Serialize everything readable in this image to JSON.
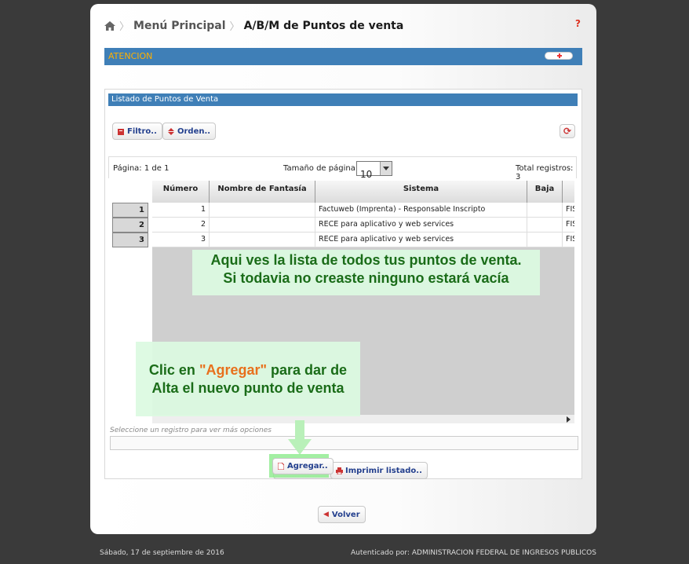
{
  "breadcrumb": {
    "home_icon": "home-icon",
    "menu": "Menú Principal",
    "current": "A/B/M de Puntos de venta"
  },
  "help": "?",
  "atencion": {
    "title": "ATENCION"
  },
  "panel": {
    "title": "Listado de Puntos de Venta"
  },
  "toolbar": {
    "filter": "Filtro..",
    "order": "Orden..",
    "refresh_icon": "refresh-icon"
  },
  "pager": {
    "page": "Página: 1 de 1",
    "size_label": "Tamaño de página:",
    "size_value": "10",
    "total": "Total registros: 3"
  },
  "grid": {
    "columns": [
      "Número",
      "Nombre de Fantasía",
      "Sistema",
      "Baja",
      ""
    ],
    "rows": [
      {
        "index": "1",
        "numero": "1",
        "nombre": "",
        "sistema": "Factuweb (Imprenta) - Responsable Inscripto",
        "baja": "",
        "extra": "FIS"
      },
      {
        "index": "2",
        "numero": "2",
        "nombre": "",
        "sistema": "RECE para aplicativo y web services",
        "baja": "",
        "extra": "FIS"
      },
      {
        "index": "3",
        "numero": "3",
        "nombre": "",
        "sistema": "RECE para aplicativo y web services",
        "baja": "",
        "extra": "FIS"
      }
    ]
  },
  "hint": "Seleccione un registro para ver más opciones",
  "actions": {
    "add": "Agregar..",
    "print": "Imprimir listado..",
    "back": "Volver"
  },
  "notes": {
    "list_line1": "Aqui ves la lista de todos tus puntos de venta.",
    "list_line2": "Si todavia no creaste ninguno estará vacía",
    "add_pre": "Clic en ",
    "add_hl": "\"Agregar\"",
    "add_post1": " para dar de",
    "add_line2": "Alta el nuevo punto de venta"
  },
  "footer": {
    "date": "Sábado, 17 de septiembre de 2016",
    "auth_label": "Autenticado por: ",
    "auth_value": "ADMINISTRACION FEDERAL DE INGRESOS PUBLICOS"
  },
  "colors": {
    "accent": "#3f7fb7",
    "warning": "#ffb000",
    "note_text": "#1a6c18",
    "highlight": "#e8701c"
  }
}
